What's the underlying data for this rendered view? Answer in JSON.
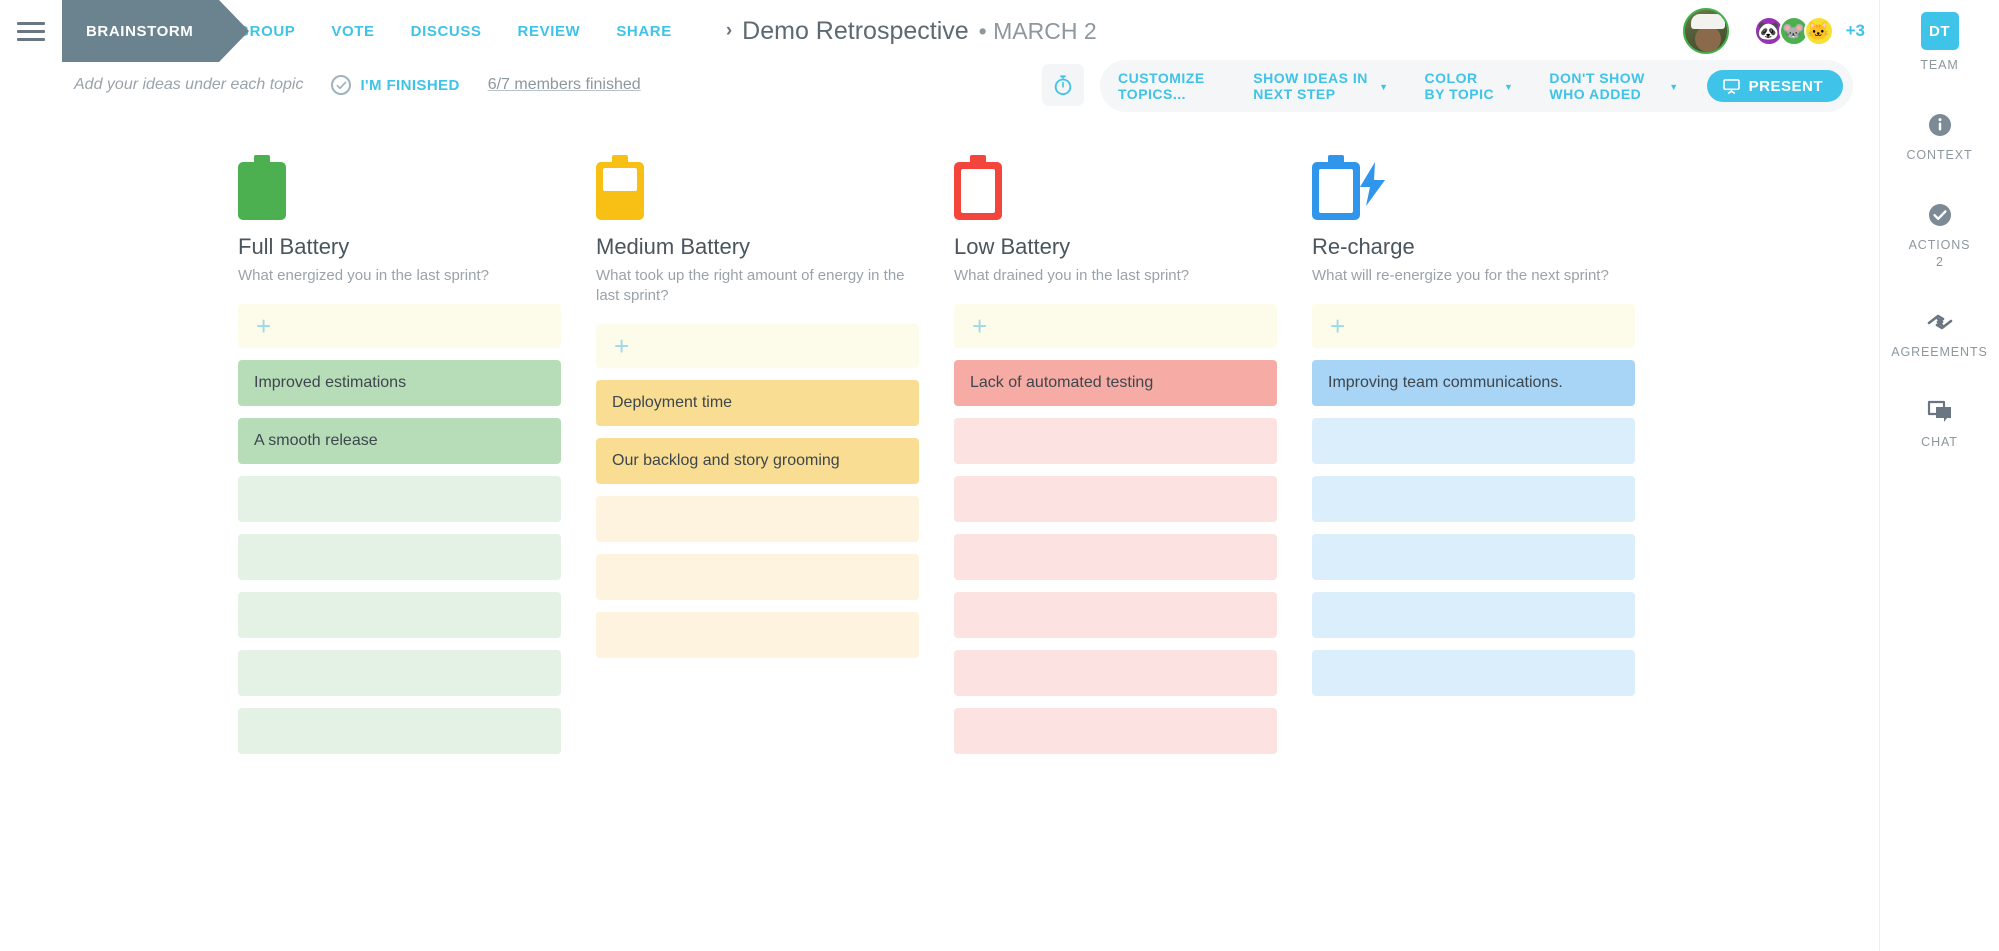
{
  "header": {
    "menu_icon": "hamburger-icon",
    "active_step": "BRAINSTORM",
    "steps": [
      "GROUP",
      "VOTE",
      "DISCUSS",
      "REVIEW",
      "SHARE"
    ],
    "title_chevron": "›",
    "title": "Demo Retrospective",
    "date": "• MARCH 2",
    "avatars": [
      {
        "name": "photo-avatar",
        "glyph": ""
      },
      {
        "name": "panda-avatar",
        "glyph": "🐼"
      },
      {
        "name": "mouse-avatar",
        "glyph": "🐭"
      },
      {
        "name": "cat-avatar",
        "glyph": "🐱"
      }
    ],
    "avatar_overflow": "+3"
  },
  "toolbar": {
    "hint": "Add your ideas under each topic",
    "finished_label": "I'M FINISHED",
    "members_finished": "6/7 members finished",
    "timer_icon": "timer-icon",
    "items": [
      {
        "label": "CUSTOMIZE TOPICS...",
        "caret": false
      },
      {
        "label": "SHOW IDEAS IN NEXT STEP",
        "caret": true
      },
      {
        "label": "COLOR BY TOPIC",
        "caret": true
      },
      {
        "label": "DON'T SHOW WHO ADDED",
        "caret": true
      }
    ],
    "present_label": "PRESENT",
    "present_icon": "presentation-icon"
  },
  "board": {
    "add_plus": "+",
    "columns": [
      {
        "icon": "battery-full-icon",
        "color": "#4caf50",
        "title": "Full Battery",
        "subtitle": "What energized you in the last sprint?",
        "cards": [
          "Improved estimations",
          "A smooth release"
        ],
        "card_color": "#b7ddb8",
        "ghost_color": "#e4f2e5",
        "ghost_count": 5
      },
      {
        "icon": "battery-medium-icon",
        "color": "#f8c015",
        "title": "Medium Battery",
        "subtitle": "What took up the right amount of energy in the last sprint?",
        "cards": [
          "Deployment time",
          "Our backlog and story grooming"
        ],
        "card_color": "#f9dd92",
        "ghost_color": "#fdf3de",
        "ghost_count": 3
      },
      {
        "icon": "battery-low-icon",
        "color": "#f4453c",
        "title": "Low Battery",
        "subtitle": "What drained you in the last sprint?",
        "cards": [
          "Lack of automated testing"
        ],
        "card_color": "#f6aca4",
        "ghost_color": "#fce3e1",
        "ghost_count": 6
      },
      {
        "icon": "battery-charging-icon",
        "color": "#2f96eb",
        "title": "Re-charge",
        "subtitle": "What will re-energize you for the next sprint?",
        "cards": [
          "Improving team communications."
        ],
        "card_color": "#a8d4f5",
        "ghost_color": "#dbeefb",
        "ghost_count": 5
      }
    ]
  },
  "rail": {
    "team_initials": "DT",
    "items": [
      {
        "label": "TEAM",
        "icon": "team-badge",
        "count": ""
      },
      {
        "label": "CONTEXT",
        "icon": "info-icon",
        "count": ""
      },
      {
        "label": "ACTIONS",
        "icon": "check-circle-icon",
        "count": "2"
      },
      {
        "label": "AGREEMENTS",
        "icon": "handshake-icon",
        "count": ""
      },
      {
        "label": "CHAT",
        "icon": "chat-icon",
        "count": ""
      }
    ]
  },
  "colors": {
    "accent": "#3fc3e8",
    "step_active_bg": "#6b838f",
    "muted_text": "#8d979e"
  }
}
